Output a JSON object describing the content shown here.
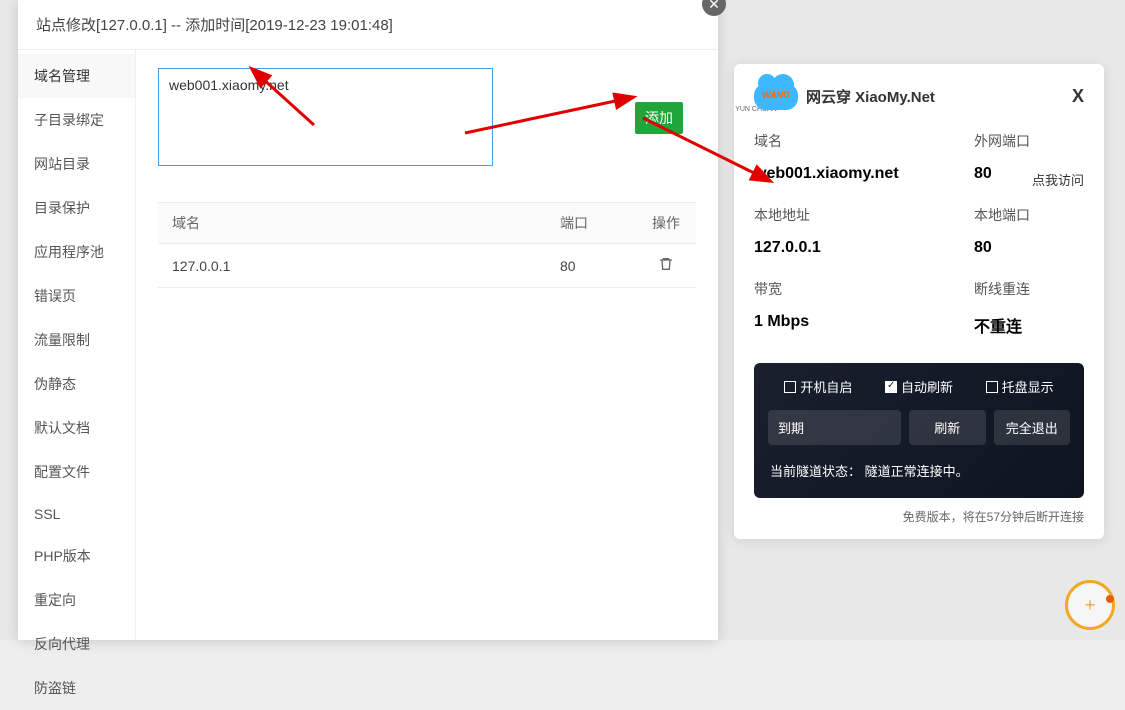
{
  "modal": {
    "title": "站点修改[127.0.0.1] -- 添加时间[2019-12-23 19:01:48]",
    "domain_input_value": "web001.xiaomy.net",
    "add_button": "添加",
    "table": {
      "headers": [
        "域名",
        "端口",
        "操作"
      ],
      "rows": [
        {
          "domain": "127.0.0.1",
          "port": "80"
        }
      ]
    }
  },
  "sidebar": {
    "items": [
      "域名管理",
      "子目录绑定",
      "网站目录",
      "目录保护",
      "应用程序池",
      "错误页",
      "流量限制",
      "伪静态",
      "默认文档",
      "配置文件",
      "SSL",
      "PHP版本",
      "重定向",
      "反向代理",
      "防盗链"
    ]
  },
  "right_panel": {
    "logo_text": "WANG",
    "logo_sub": "YUN CHUAN",
    "title": "网云穿 XiaoMy.Net",
    "close": "X",
    "labels": {
      "domain": "域名",
      "ext_port": "外网端口",
      "local_addr": "本地地址",
      "local_port": "本地端口",
      "bandwidth": "带宽",
      "reconnect": "断线重连"
    },
    "values": {
      "domain": "web001.xiaomy.net",
      "ext_port": "80",
      "local_addr": "127.0.0.1",
      "local_port": "80",
      "bandwidth": "1 Mbps",
      "reconnect": "不重连"
    },
    "visit_link": "点我访问",
    "dark_box": {
      "chk1": "开机自启",
      "chk2": "自动刷新",
      "chk3": "托盘显示",
      "expire": "到期",
      "refresh": "刷新",
      "exit": "完全退出",
      "status_label": "当前隧道状态：",
      "status_value": "隧道正常连接中。"
    },
    "footer": "免费版本，将在57分钟后断开连接"
  }
}
